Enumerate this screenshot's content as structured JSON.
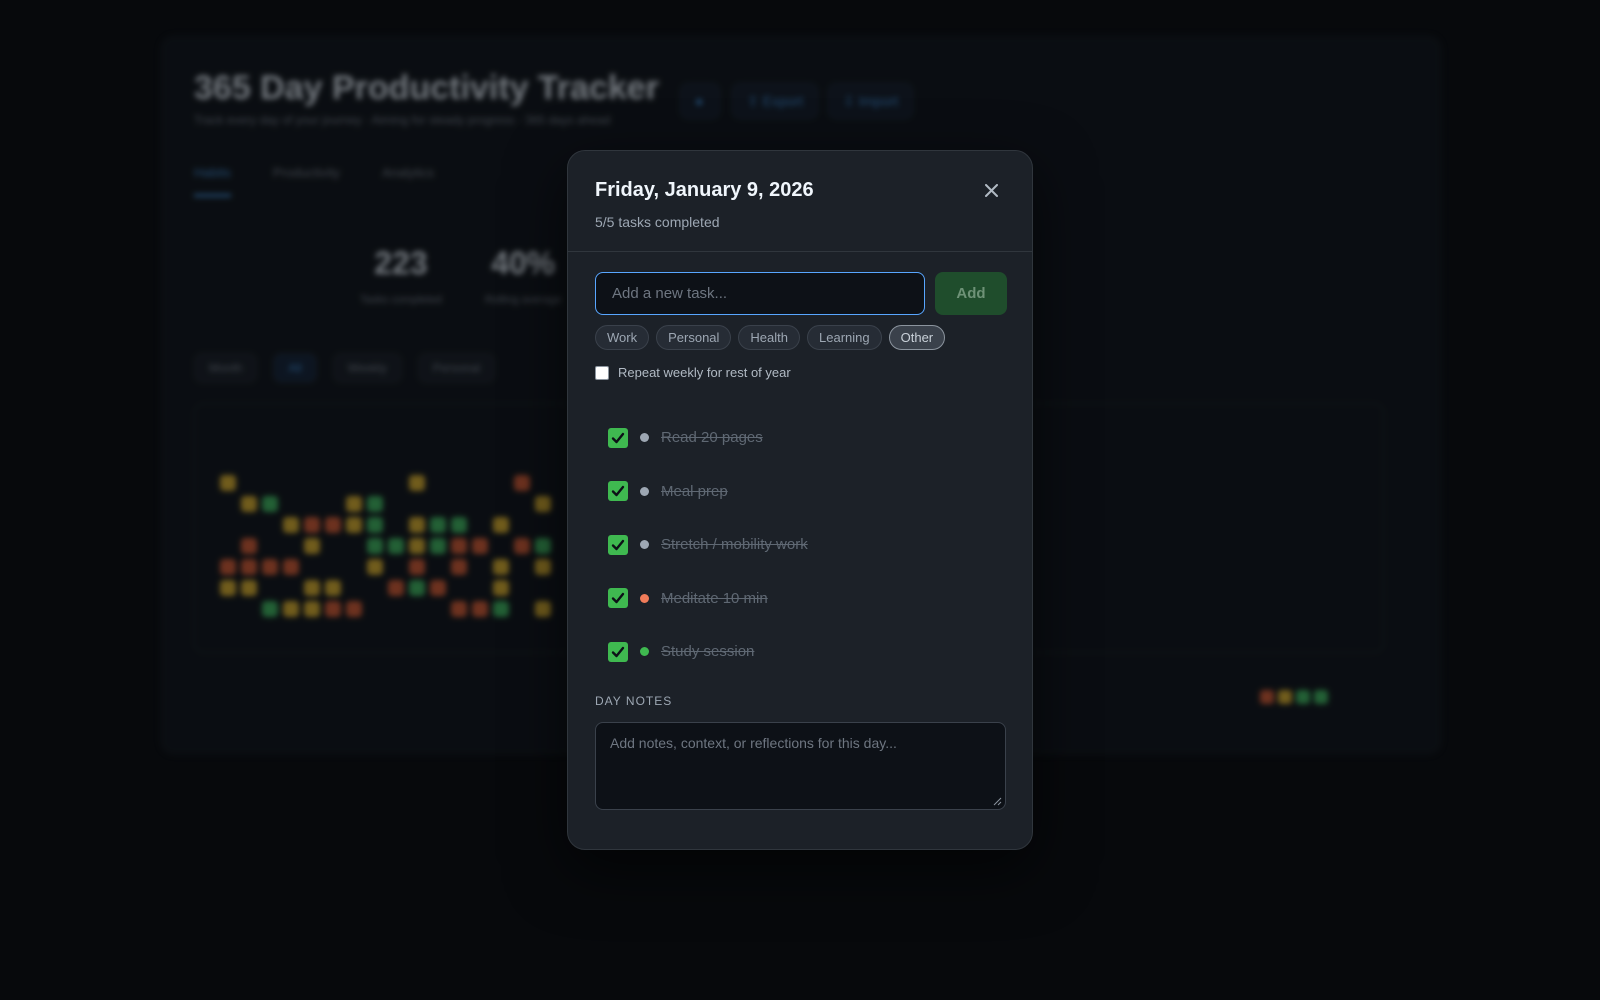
{
  "background": {
    "title": "365 Day Productivity Tracker",
    "subtitle": "Track every day of your journey · Aiming for steady progress · 365 days ahead",
    "top_buttons": [
      {
        "icon": "moon-icon",
        "label": ""
      },
      {
        "icon": "export-icon",
        "label": "Export"
      },
      {
        "icon": "import-icon",
        "label": "Import"
      }
    ],
    "tabs": [
      "Habits",
      "Productivity",
      "Analytics"
    ],
    "stats": [
      {
        "value": "223",
        "label": "Tasks completed"
      },
      {
        "value": "40%",
        "label": "Rolling average"
      }
    ],
    "filters": [
      "Month",
      "All",
      "Weekly",
      "Personal"
    ],
    "colors": {
      "low": "#c0532f",
      "mid": "#c7a02a",
      "high": "#3aa757"
    }
  },
  "modal": {
    "title": "Friday, January 9, 2026",
    "subtitle": "5/5 tasks completed",
    "close_icon": "close-icon",
    "task_input_placeholder": "Add a new task...",
    "add_label": "Add",
    "categories": [
      {
        "label": "Work",
        "selected": false
      },
      {
        "label": "Personal",
        "selected": false
      },
      {
        "label": "Health",
        "selected": false
      },
      {
        "label": "Learning",
        "selected": false
      },
      {
        "label": "Other",
        "selected": true
      }
    ],
    "repeat_label": "Repeat weekly for rest of year",
    "repeat_checked": false,
    "tasks": [
      {
        "text": "Read 20 pages",
        "done": true,
        "dot_color": "#9da7b3"
      },
      {
        "text": "Meal prep",
        "done": true,
        "dot_color": "#9da7b3"
      },
      {
        "text": "Stretch / mobility work",
        "done": true,
        "dot_color": "#9da7b3"
      },
      {
        "text": "Meditate 10 min",
        "done": true,
        "dot_color": "#f07c5a"
      },
      {
        "text": "Study session",
        "done": true,
        "dot_color": "#3fb950"
      }
    ],
    "notes_label": "DAY NOTES",
    "notes_placeholder": "Add notes, context, or reflections for this day...",
    "accent_color": "#58a6ff",
    "check_color": "#3fb950"
  }
}
